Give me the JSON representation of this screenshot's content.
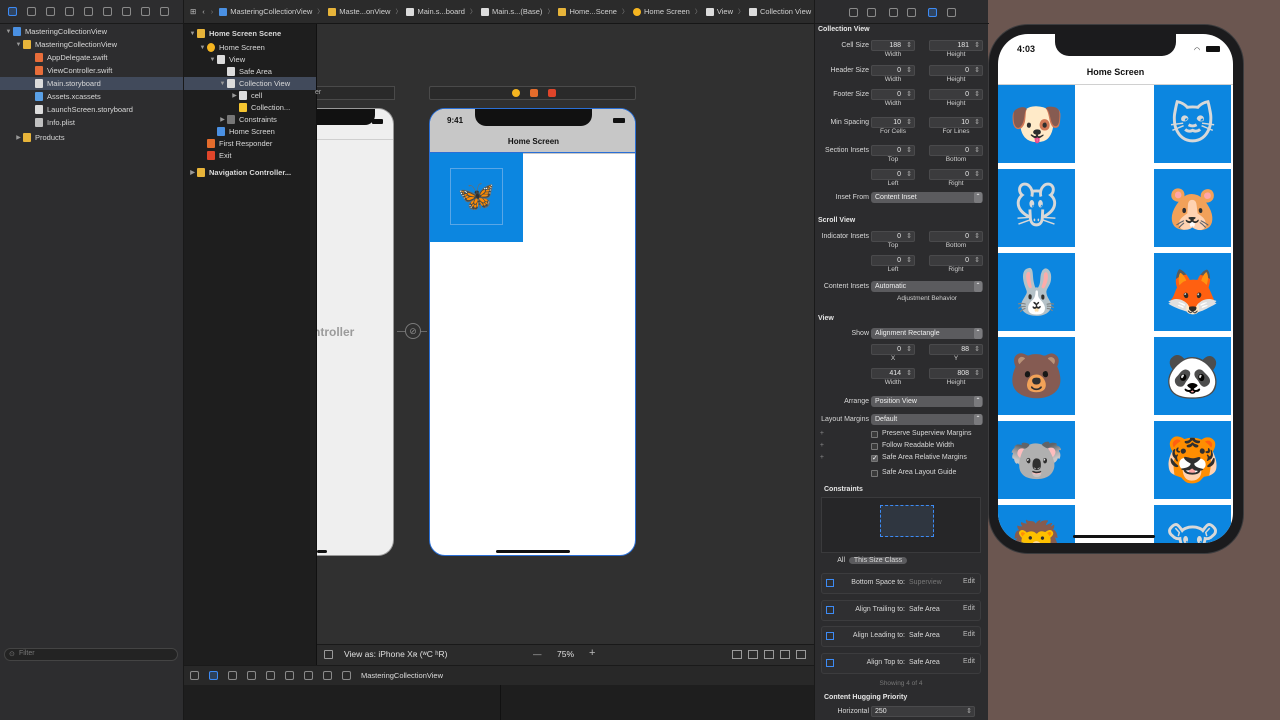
{
  "navigator": {
    "items": [
      {
        "label": "MasteringCollectionView",
        "type": "project"
      },
      {
        "label": "MasteringCollectionView",
        "type": "folder"
      },
      {
        "label": "AppDelegate.swift",
        "type": "swift"
      },
      {
        "label": "ViewController.swift",
        "type": "swift"
      },
      {
        "label": "Main.storyboard",
        "type": "storyboard"
      },
      {
        "label": "Assets.xcassets",
        "type": "assets"
      },
      {
        "label": "LaunchScreen.storyboard",
        "type": "storyboard"
      },
      {
        "label": "Info.plist",
        "type": "plist"
      },
      {
        "label": "Products",
        "type": "folder"
      }
    ],
    "filter_placeholder": "Filter"
  },
  "jumpbar": {
    "crumbs": [
      "MasteringCollectionView",
      "Maste...onView",
      "Main.s...board",
      "Main.s...(Base)",
      "Home...Scene",
      "Home Screen",
      "View",
      "Collection View"
    ]
  },
  "outline": {
    "items": [
      "Home Screen Scene",
      "Home Screen",
      "View",
      "Safe Area",
      "Collection View",
      "cell",
      "Collection...",
      "Constraints",
      "Home Screen",
      "First Responder",
      "Exit",
      "Navigation Controller..."
    ]
  },
  "canvas": {
    "left_scene_text": "ntroller",
    "left_scene_tab": "er",
    "phone_time": "9:41",
    "nav_title": "Home Screen",
    "cell_emoji": "🦋",
    "view_as": "View as: iPhone Xʀ (ʷC ʰR)",
    "zoom": "75%",
    "minus": "—",
    "plus": "+"
  },
  "bottom_bar": {
    "scheme": "MasteringCollectionView"
  },
  "inspector": {
    "collection_view_title": "Collection View",
    "cell_size_label": "Cell Size",
    "cell_width": "188",
    "cell_height": "181",
    "header_size_label": "Header Size",
    "header_width": "0",
    "header_height": "0",
    "footer_size_label": "Footer Size",
    "footer_width": "0",
    "footer_height": "0",
    "min_spacing_label": "Min Spacing",
    "spacing_cells": "10",
    "spacing_lines": "10",
    "for_cells": "For Cells",
    "for_lines": "For Lines",
    "width": "Width",
    "height": "Height",
    "top": "Top",
    "bottom": "Bottom",
    "left": "Left",
    "right": "Right",
    "section_insets_label": "Section Insets",
    "si_top": "0",
    "si_bottom": "0",
    "si_left": "0",
    "si_right": "0",
    "inset_from_label": "Inset From",
    "inset_from": "Content Inset",
    "scroll_view_title": "Scroll View",
    "indicator_insets_label": "Indicator Insets",
    "ii_top": "0",
    "ii_bottom": "0",
    "ii_left": "0",
    "ii_right": "0",
    "content_insets_label": "Content Insets",
    "content_insets": "Automatic",
    "adjustment_behavior": "Adjustment Behavior",
    "view_title": "View",
    "show_label": "Show",
    "show": "Alignment Rectangle",
    "x_label": "X",
    "y_label": "Y",
    "x": "0",
    "y": "88",
    "w": "414",
    "h": "808",
    "arrange_label": "Arrange",
    "arrange": "Position View",
    "layout_margins_label": "Layout Margins",
    "layout_margins": "Default",
    "preserve": "Preserve Superview Margins",
    "follow": "Follow Readable Width",
    "safe_rel": "Safe Area Relative Margins",
    "safe_guide": "Safe Area Layout Guide",
    "constraints_title": "Constraints",
    "all": "All",
    "this_size_class": "This Size Class",
    "constraints": [
      {
        "label": "Bottom Space to:",
        "target": "Superview",
        "edit": "Edit",
        "dim": true
      },
      {
        "label": "Align Trailing to:",
        "target": "Safe Area",
        "edit": "Edit",
        "dim": false
      },
      {
        "label": "Align Leading to:",
        "target": "Safe Area",
        "edit": "Edit",
        "dim": false
      },
      {
        "label": "Align Top to:",
        "target": "Safe Area",
        "edit": "Edit",
        "dim": false
      }
    ],
    "showing": "Showing 4 of 4",
    "hugging_title": "Content Hugging Priority",
    "horizontal_label": "Horizontal",
    "horizontal": "250"
  },
  "simulator": {
    "time": "4:03",
    "title": "Home Screen",
    "left_column": [
      "🐶",
      "🐭",
      "🐰",
      "🐻",
      "🐨",
      "🦁"
    ],
    "right_column": [
      "🐱",
      "🐹",
      "🦊",
      "🐼",
      "🐯",
      "🐮"
    ],
    "cell_color": "#0c86e0"
  },
  "colors": {
    "accent": "#3d8bf5",
    "selection": "#414a5b"
  }
}
